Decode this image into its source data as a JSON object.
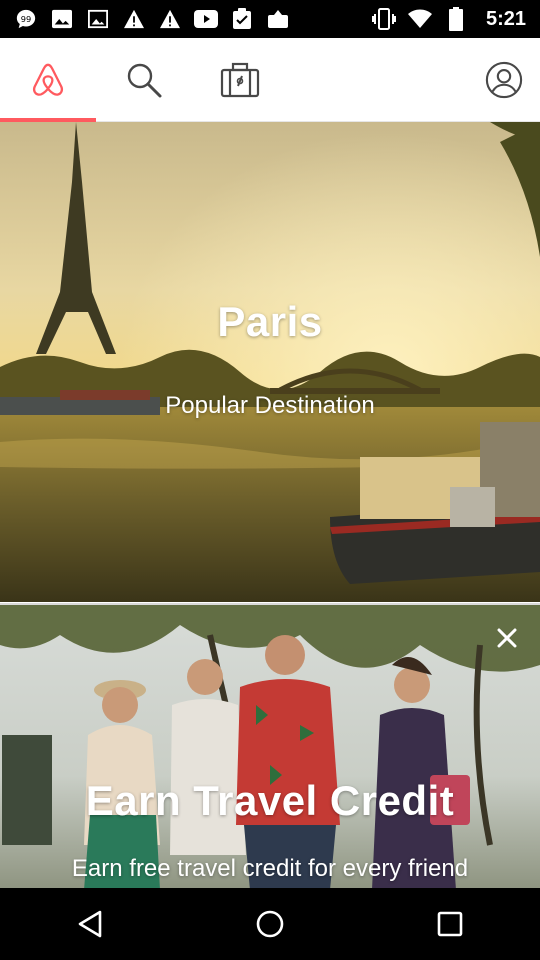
{
  "status_bar": {
    "time": "5:21",
    "left_icons": [
      "chat-icon",
      "image-icon",
      "image-icon",
      "warning-icon",
      "warning-icon",
      "youtube-icon",
      "clipboard-check-icon",
      "upload-icon"
    ],
    "right_icons": [
      "vibrate-icon",
      "wifi-icon",
      "battery-icon"
    ]
  },
  "top_nav": {
    "tabs": [
      {
        "name": "home",
        "icon": "airbnb-logo-icon",
        "active": true
      },
      {
        "name": "search",
        "icon": "search-icon",
        "active": false
      },
      {
        "name": "trips",
        "icon": "suitcase-icon",
        "active": false
      },
      {
        "name": "profile",
        "icon": "profile-icon",
        "active": false
      }
    ],
    "accent_color": "#ff5a5f"
  },
  "cards": {
    "destination": {
      "title": "Paris",
      "subtitle": "Popular Destination"
    },
    "promo": {
      "title": "Earn Travel Credit",
      "subtitle": "Earn free travel credit for every friend"
    }
  },
  "system_nav": {
    "buttons": [
      "back-icon",
      "home-circle-icon",
      "recents-icon"
    ]
  }
}
